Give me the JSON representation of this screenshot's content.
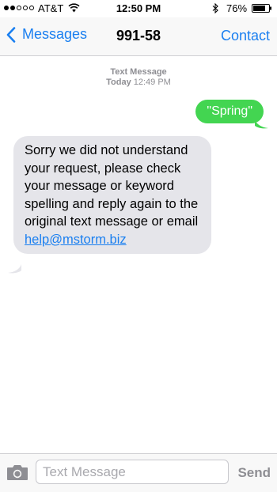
{
  "status_bar": {
    "carrier": "AT&T",
    "time": "12:50 PM",
    "battery": "76%",
    "battery_level": 0.76,
    "signal_bars": 2,
    "signal_total": 5
  },
  "nav": {
    "back_label": "Messages",
    "title": "991-58",
    "contact_label": "Contact",
    "accent_color": "#1a7ff0"
  },
  "conversation": {
    "header_type": "Text Message",
    "header_day": "Today",
    "header_time": "12:49 PM",
    "outgoing": {
      "text": "\"Spring\"",
      "color": "#43d551"
    },
    "incoming": {
      "text": "Sorry we did not understand your request, please check your message or keyword spelling and reply again to the original text message or email ",
      "link": "help@mstorm.biz",
      "color": "#e5e5ea"
    }
  },
  "input_bar": {
    "placeholder": "Text Message",
    "send_label": "Send",
    "camera_icon": "camera-icon"
  }
}
